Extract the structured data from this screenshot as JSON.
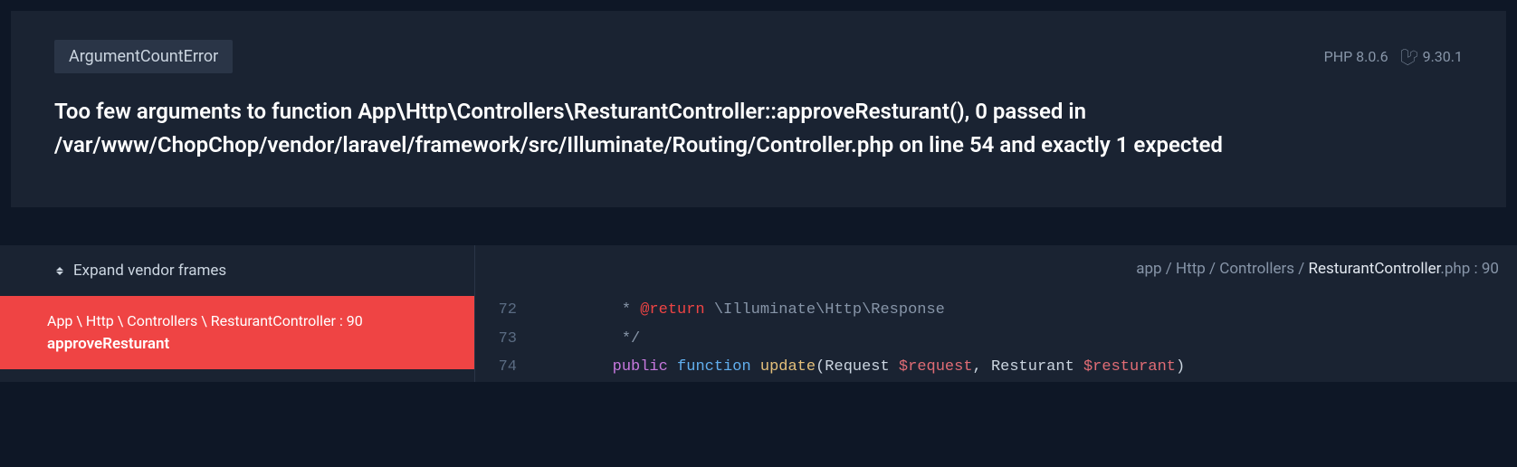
{
  "error": {
    "type": "ArgumentCountError",
    "message": "Too few arguments to function App\\Http\\Controllers\\ResturantController::approveResturant(), 0 passed in /var/www/ChopChop/vendor/laravel/framework/src/Illuminate/Routing/Controller.php on line 54 and exactly 1 expected"
  },
  "versions": {
    "php": "PHP 8.0.6",
    "laravel": "9.30.1"
  },
  "sidebar": {
    "expand_label": "Expand vendor frames",
    "frame": {
      "path": "App \\ Http \\ Controllers \\ ResturantController : 90",
      "method": "approveResturant"
    }
  },
  "code": {
    "path_prefix": "app / Http / Controllers / ",
    "path_file": "ResturantController",
    "path_suffix": ".php : 90",
    "lines": [
      {
        "num": "72",
        "tokens": [
          {
            "t": "         * ",
            "c": "tok-comment"
          },
          {
            "t": "@return",
            "c": "tok-tag"
          },
          {
            "t": " \\Illuminate\\Http\\Response",
            "c": "tok-comment"
          }
        ]
      },
      {
        "num": "73",
        "tokens": [
          {
            "t": "         */",
            "c": "tok-comment"
          }
        ]
      },
      {
        "num": "74",
        "tokens": [
          {
            "t": "        ",
            "c": ""
          },
          {
            "t": "public",
            "c": "tok-keyword"
          },
          {
            "t": " ",
            "c": ""
          },
          {
            "t": "function",
            "c": "tok-keyword2"
          },
          {
            "t": " ",
            "c": ""
          },
          {
            "t": "update",
            "c": "tok-function"
          },
          {
            "t": "(",
            "c": ""
          },
          {
            "t": "Request ",
            "c": "tok-type"
          },
          {
            "t": "$request",
            "c": "tok-var"
          },
          {
            "t": ", Resturant ",
            "c": "tok-type"
          },
          {
            "t": "$resturant",
            "c": "tok-var"
          },
          {
            "t": ")",
            "c": ""
          }
        ]
      }
    ]
  }
}
